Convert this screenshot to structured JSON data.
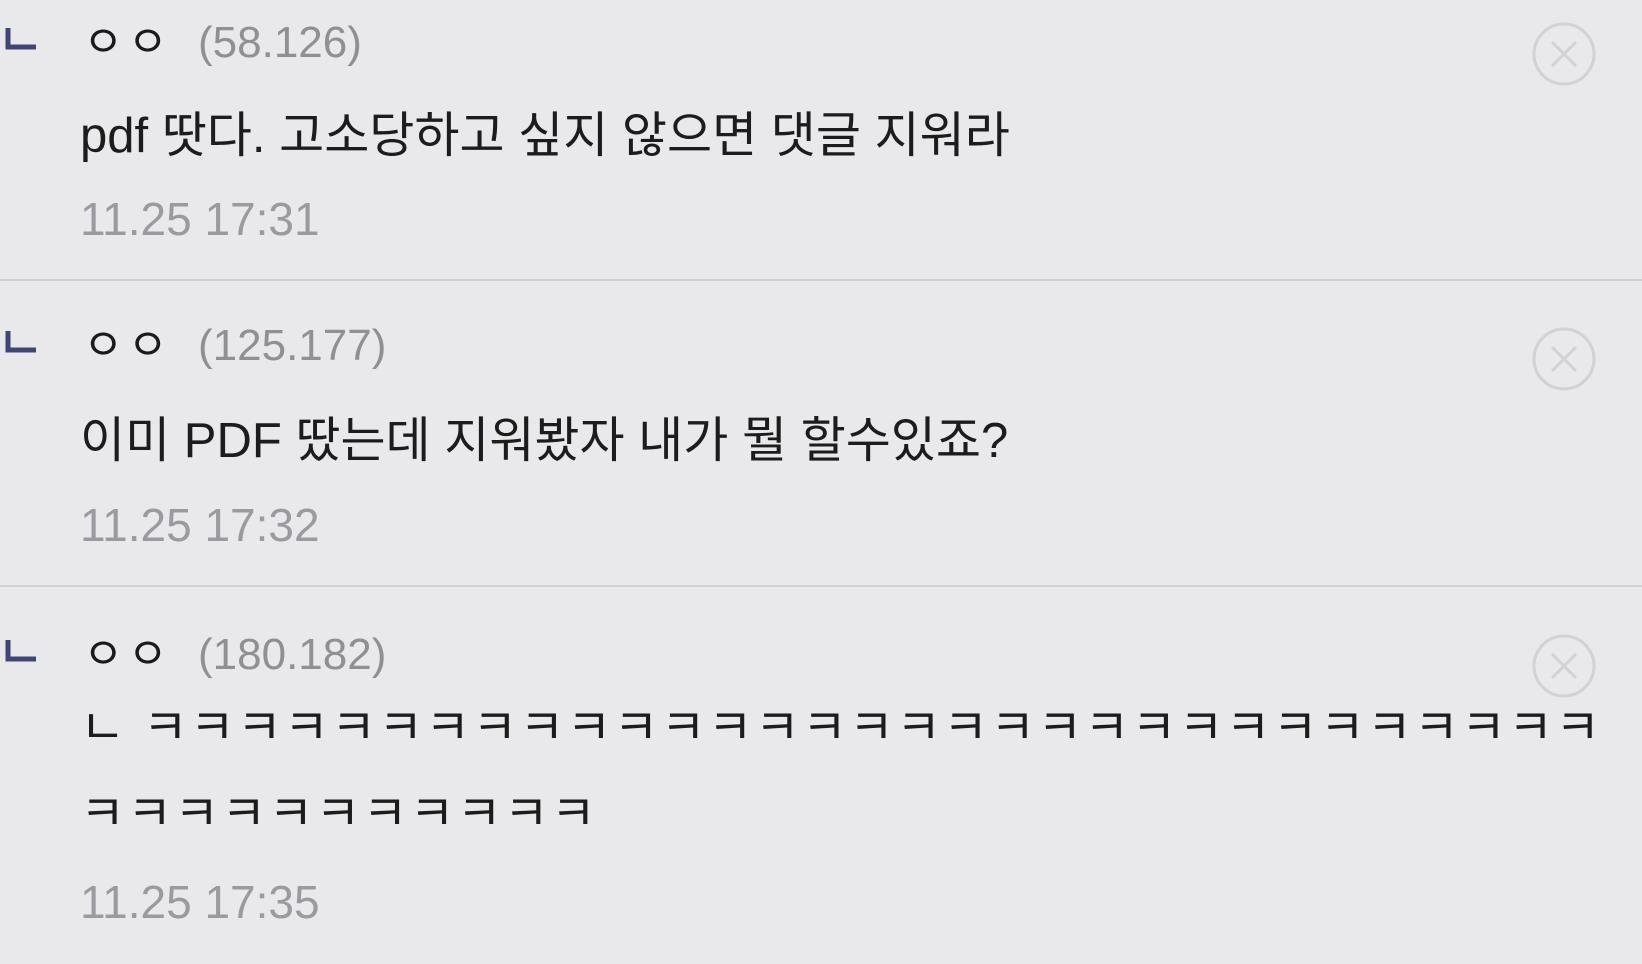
{
  "icons": {
    "reply": "reply-arrow-icon",
    "delete": "close-circle-icon"
  },
  "colors": {
    "background": "#e9e9ec",
    "reply_mark": "#3f4676",
    "meta_text": "#9a9aa0",
    "divider": "#cfd0d6"
  },
  "comments": [
    {
      "author": "ㅇㅇ",
      "ip": "(58.126)",
      "body": "pdf 땃다. 고소당하고 싶지 않으면 댓글 지워라",
      "timestamp": "11.25 17:31"
    },
    {
      "author": "ㅇㅇ",
      "ip": "(125.177)",
      "body": "이미 PDF 땄는데 지워봤자 내가 뭘 할수있죠?",
      "timestamp": "11.25 17:32"
    },
    {
      "author": "ㅇㅇ",
      "ip": "(180.182)",
      "body": "ㄴ ㅋㅋㅋㅋㅋㅋㅋㅋㅋㅋㅋㅋㅋㅋㅋㅋㅋㅋㅋㅋㅋㅋㅋㅋㅋㅋㅋㅋㅋㅋㅋㅋㅋㅋㅋㅋㅋㅋㅋㅋㅋㅋ",
      "timestamp": "11.25 17:35"
    }
  ]
}
